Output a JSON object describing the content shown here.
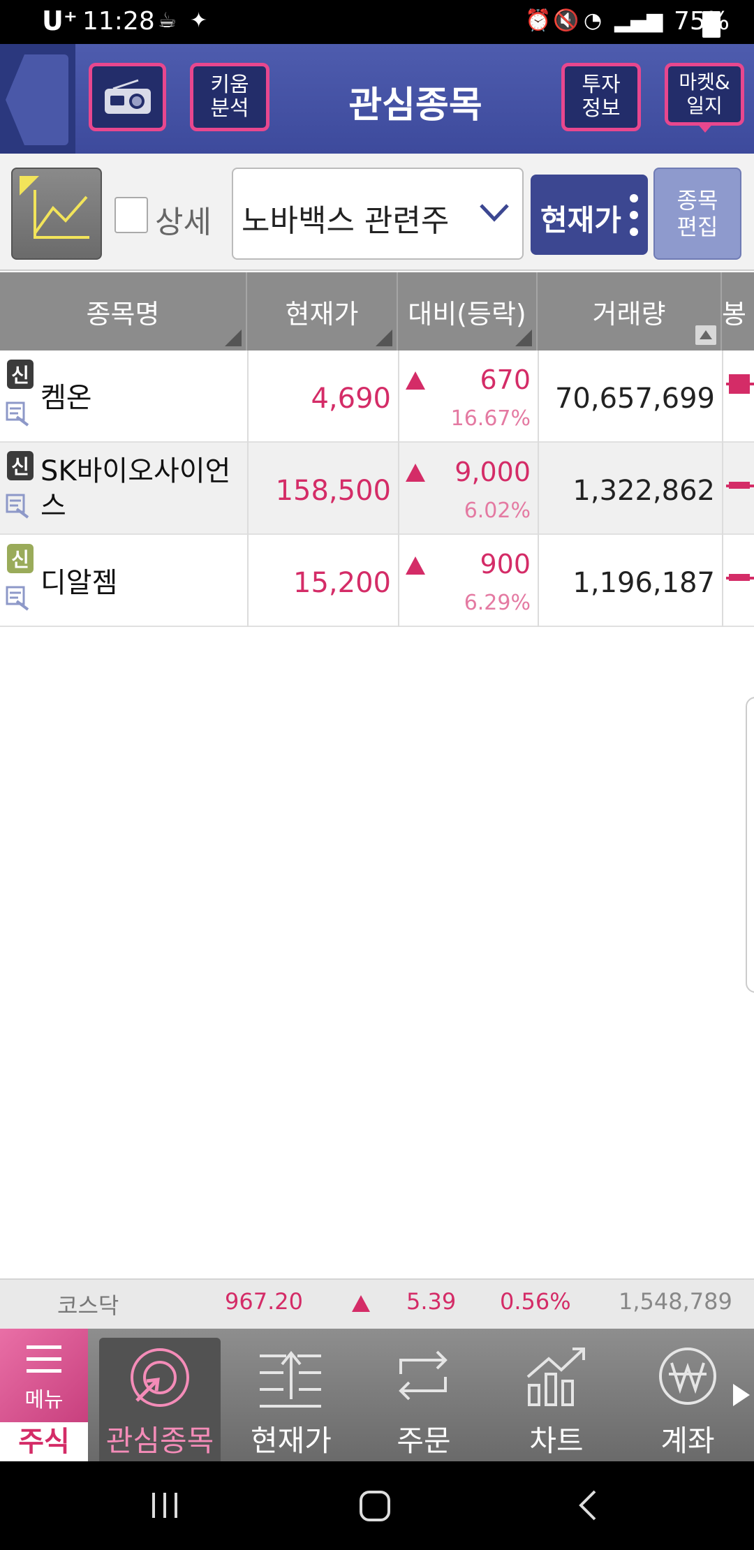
{
  "status_bar": {
    "carrier": "U⁺",
    "time": "11:28",
    "battery": "75%"
  },
  "header": {
    "title": "관심종목",
    "kiwoom_analysis": "키움\n분석",
    "invest_info": "투자\n정보",
    "market_diary": "마켓&\n일지"
  },
  "toolbar": {
    "detail_label": "상세",
    "group_select": "노바백스 관련주",
    "price_button": "현재가",
    "edit_button": "종목\n편집"
  },
  "table": {
    "headers": [
      "종목명",
      "현재가",
      "대비(등락)",
      "거래량",
      "봉"
    ],
    "rows": [
      {
        "badge": "신",
        "name": "켐온",
        "price": "4,690",
        "change": "670",
        "rate": "16.67%",
        "volume": "70,657,699"
      },
      {
        "badge": "신",
        "name": "SK바이오사이언\n스",
        "price": "158,500",
        "change": "9,000",
        "rate": "6.02%",
        "volume": "1,322,862"
      },
      {
        "badge": "신",
        "name": "디알젬",
        "price": "15,200",
        "change": "900",
        "rate": "6.29%",
        "volume": "1,196,187"
      }
    ]
  },
  "index_bar": {
    "name": "코스닥",
    "value": "967.20",
    "change": "5.39",
    "rate": "0.56%",
    "volume": "1,548,789"
  },
  "bottom_nav": {
    "menu": "메뉴",
    "stock": "주식",
    "items": [
      "관심종목",
      "현재가",
      "주문",
      "차트",
      "계좌"
    ]
  },
  "colors": {
    "accent": "#d42c67",
    "header_blue": "#3d4a9c",
    "highlight_pink": "#e8478e"
  }
}
